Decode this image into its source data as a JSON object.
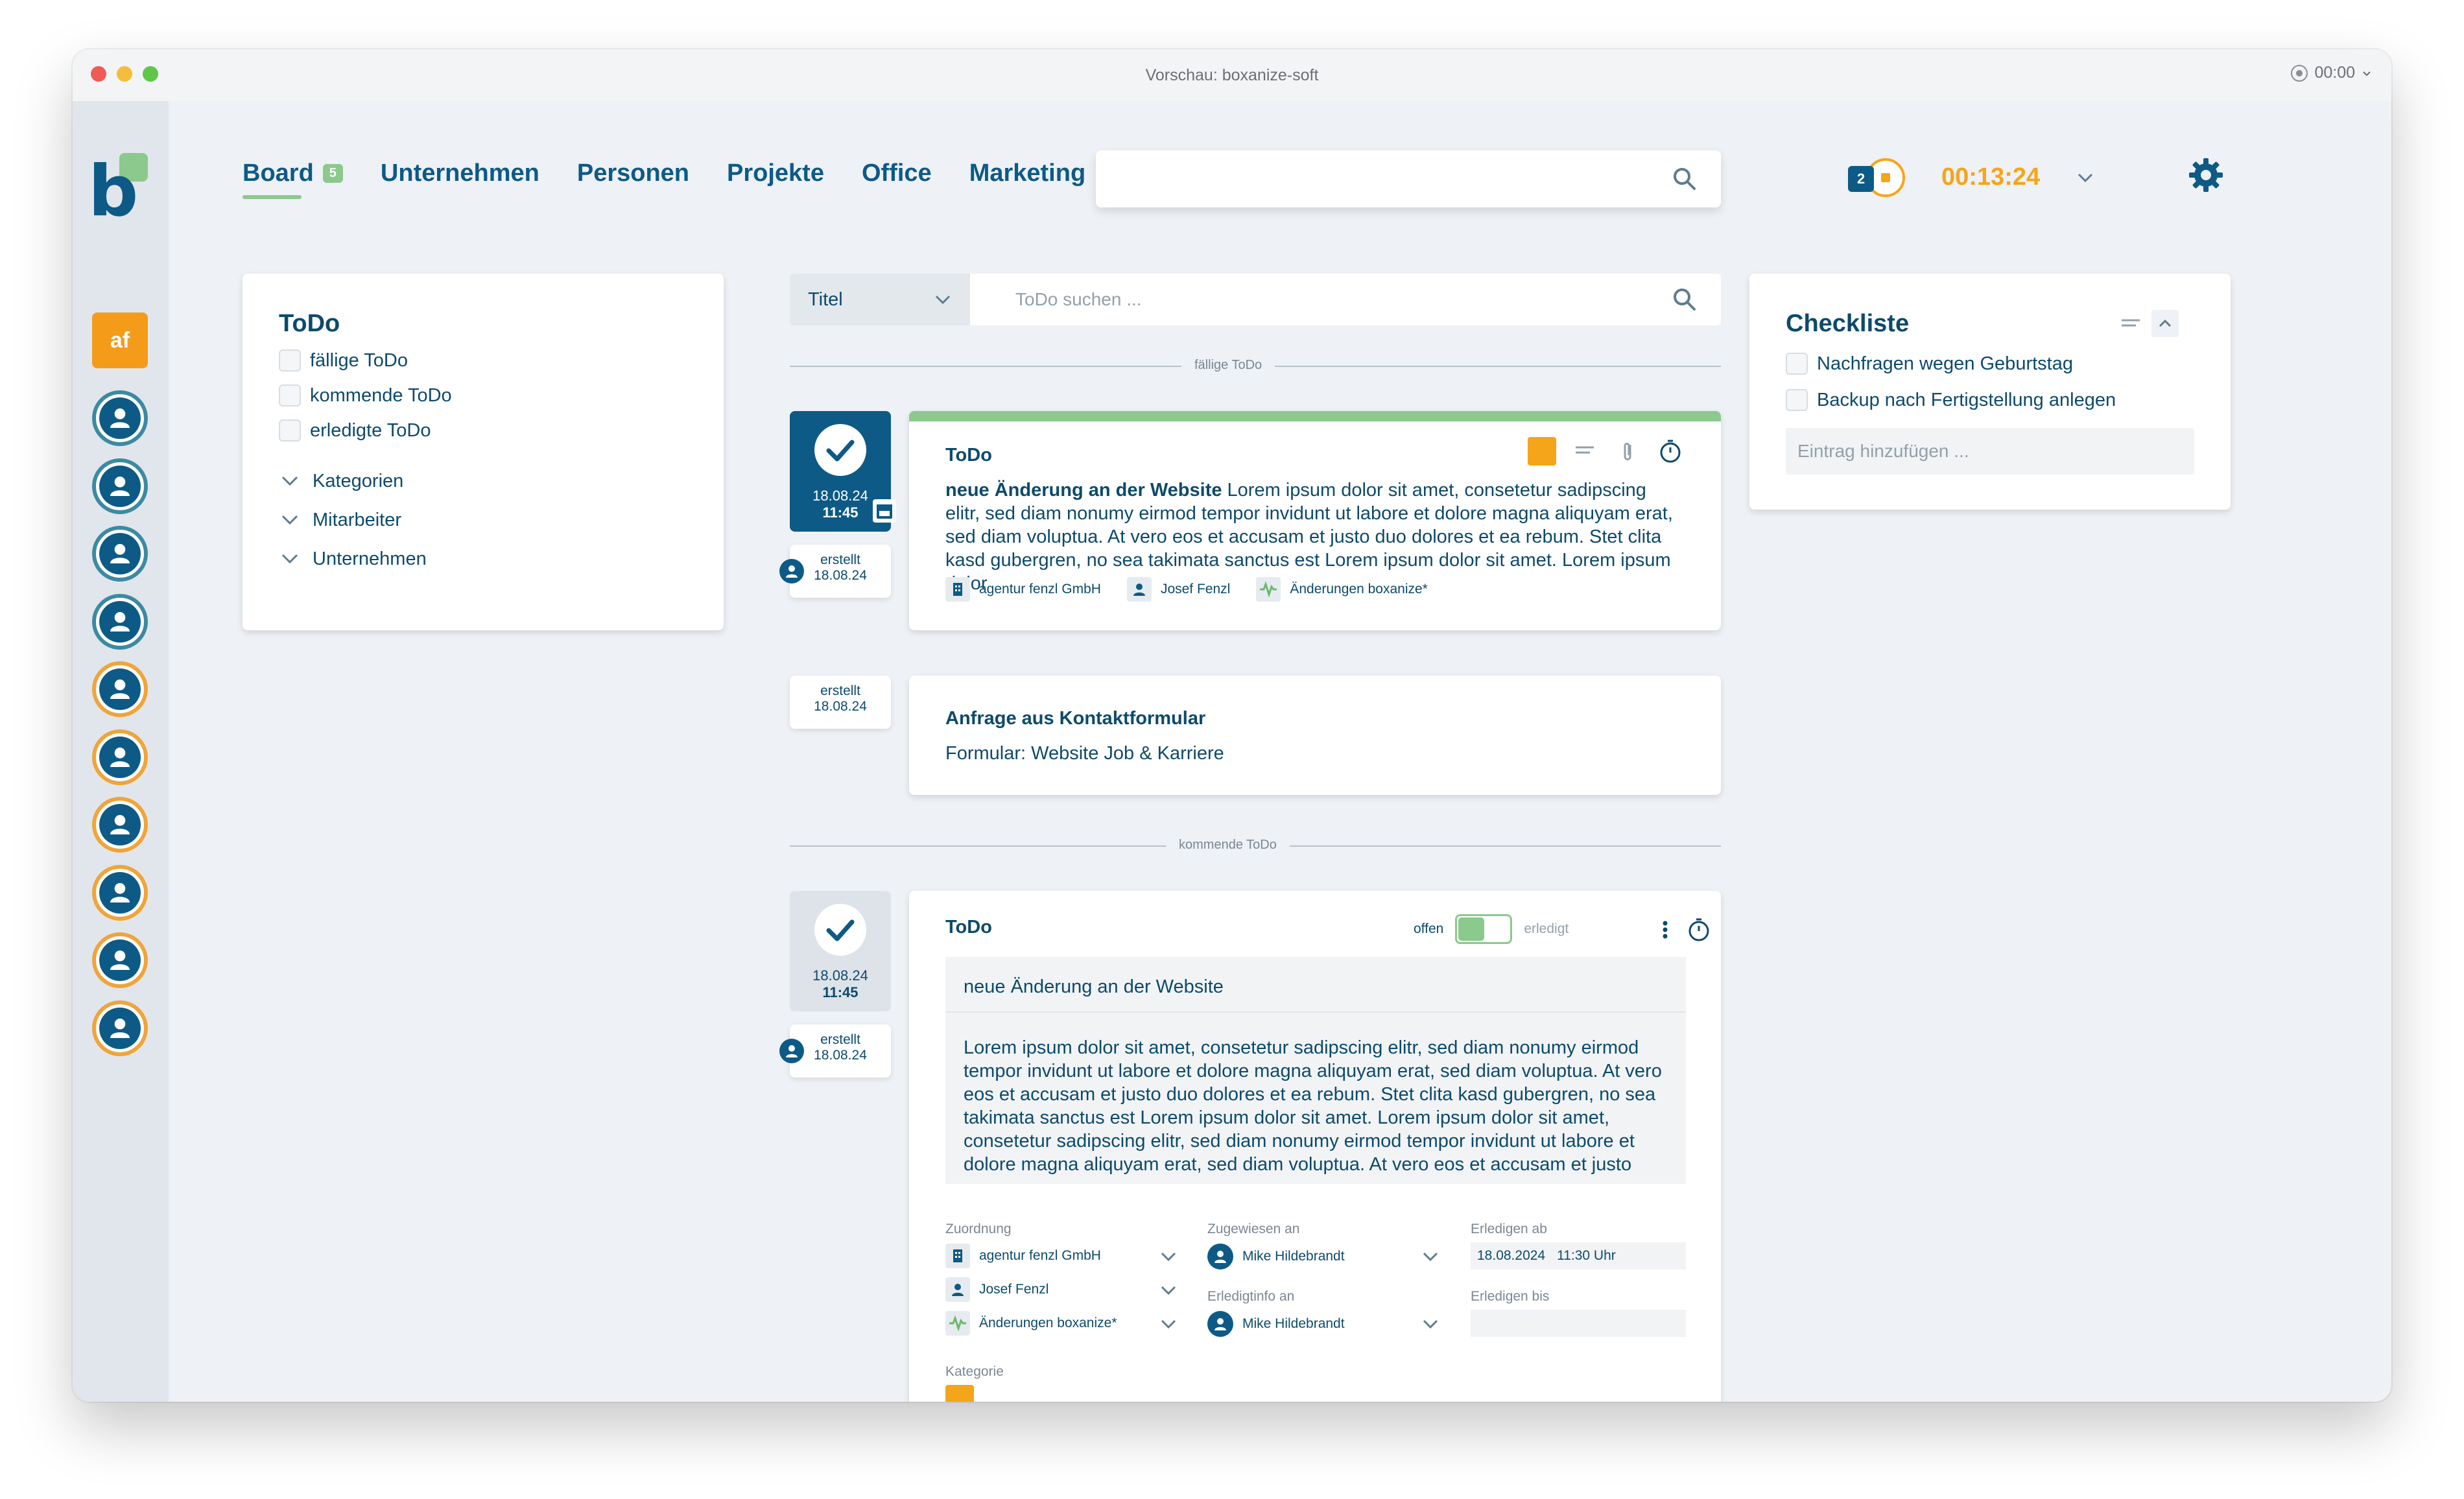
{
  "window": {
    "title": "Vorschau: boxanize-soft",
    "timer": "00:00"
  },
  "sidebar": {
    "user_initials": "af",
    "avatars": [
      {
        "ring": "#3c8aa2"
      },
      {
        "ring": "#3c8aa2"
      },
      {
        "ring": "#3c8aa2"
      },
      {
        "ring": "#3c8aa2"
      },
      {
        "ring": "#f0a43a"
      },
      {
        "ring": "#f0a43a"
      },
      {
        "ring": "#f0a43a"
      },
      {
        "ring": "#f0a43a"
      },
      {
        "ring": "#f0a43a"
      },
      {
        "ring": "#f0a43a"
      }
    ]
  },
  "nav": {
    "tabs": [
      {
        "label": "Board",
        "badge": "5",
        "active": true
      },
      {
        "label": "Unternehmen"
      },
      {
        "label": "Personen"
      },
      {
        "label": "Projekte"
      },
      {
        "label": "Office"
      },
      {
        "label": "Marketing"
      }
    ]
  },
  "header": {
    "notification_count": "2",
    "timer": "00:13:24"
  },
  "filters": {
    "title": "ToDo",
    "checks": [
      "fällige ToDo",
      "kommende ToDo",
      "erledigte ToDo"
    ],
    "groups": [
      "Kategorien",
      "Mitarbeiter",
      "Unternehmen"
    ]
  },
  "todo_search": {
    "select_value": "Titel",
    "placeholder": "ToDo suchen ..."
  },
  "sections": {
    "due": "fällige ToDo",
    "upcoming": "kommende ToDo"
  },
  "todo1": {
    "date": "18.08.24",
    "time": "11:45",
    "created_label": "erstellt",
    "created_date": "18.08.24",
    "heading": "ToDo",
    "title": "neue Änderung an der Website",
    "body": " Lorem ipsum dolor sit amet, consetetur sadipscing elitr, sed diam nonumy eirmod tempor invidunt ut labore et dolore magna aliquyam erat, sed diam voluptua. At vero eos et accusam et justo duo dolores et ea rebum. Stet clita kasd gubergren, no sea takimata sanctus est Lorem ipsum dolor sit amet. Lorem ipsum dolor",
    "company": "agentur fenzl GmbH",
    "person": "Josef Fenzl",
    "project": "Änderungen boxanize*",
    "accent": "#8bc98c",
    "category_color": "#f5a51a"
  },
  "request": {
    "created_label": "erstellt",
    "created_date": "18.08.24",
    "title": "Anfrage aus Kontaktformular",
    "subtitle": "Formular: Website Job & Karriere"
  },
  "todo2": {
    "date": "18.08.24",
    "time": "11:45",
    "created_label": "erstellt",
    "created_date": "18.08.24",
    "heading": "ToDo",
    "status_open": "offen",
    "status_done": "erledigt",
    "title": "neue Änderung an der Website",
    "body": "Lorem ipsum dolor sit amet, consetetur sadipscing elitr, sed diam nonumy eirmod tempor invidunt ut labore et dolore magna aliquyam erat, sed diam voluptua. At vero eos et accusam et justo duo dolores et ea rebum. Stet clita kasd gubergren, no sea takimata sanctus est Lorem ipsum dolor sit amet. Lorem ipsum dolor sit amet, consetetur sadipscing elitr, sed diam nonumy eirmod tempor invidunt ut labore et dolore magna aliquyam erat, sed diam voluptua. At vero eos et accusam et justo",
    "assign_label": "Zuordnung",
    "company": "agentur fenzl GmbH",
    "person": "Josef Fenzl",
    "project": "Änderungen boxanize*",
    "assigned_label": "Zugewiesen an",
    "assigned": "Mike Hildebrandt",
    "doneinfo_label": "Erledigtinfo an",
    "doneinfo": "Mike Hildebrandt",
    "from_label": "Erledigen ab",
    "from_date": "18.08.2024",
    "from_time": "11:30 Uhr",
    "until_label": "Erledigen bis",
    "category_label": "Kategorie"
  },
  "checklist": {
    "title": "Checkliste",
    "items": [
      "Nachfragen wegen Geburtstag",
      "Backup nach Fertigstellung anlegen"
    ],
    "placeholder": "Eintrag hinzufügen ..."
  }
}
